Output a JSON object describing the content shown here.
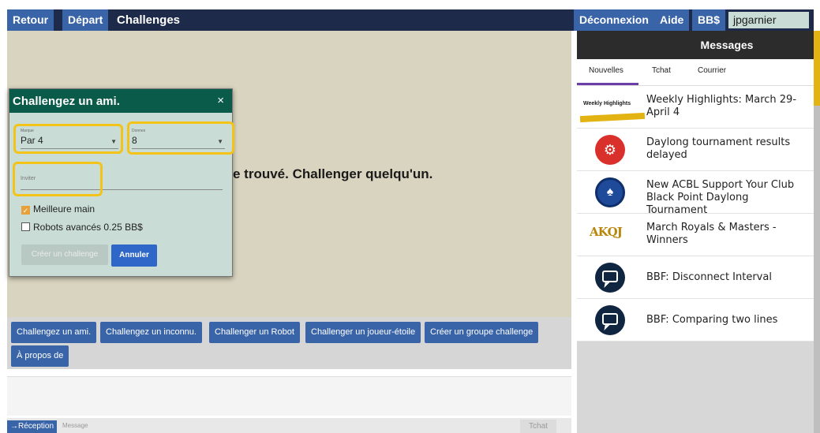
{
  "topbar": {
    "retour": "Retour",
    "depart": "Départ",
    "title": "Challenges",
    "deconnexion": "Déconnexion",
    "aide": "Aide",
    "bbs": "BB$",
    "username": "jpgarnier"
  },
  "main": {
    "empty_message": "e trouvé. Challenger quelqu'un."
  },
  "dialog": {
    "title": "Challengez un ami.",
    "close": "×",
    "scoring_label": "Marque",
    "scoring_value": "Par 4",
    "boards_label": "Donnes",
    "boards_value": "8",
    "invite_placeholder": "Inviter",
    "best_hand_label": "Meilleure main",
    "best_hand_checked": true,
    "robots_label": "Robots avancés 0.25 BB$",
    "robots_checked": false,
    "create_button": "Créer un challenge",
    "cancel_button": "Annuler",
    "highlight_color": "#f3c31a"
  },
  "actions": {
    "buttons": [
      "Challengez un ami.",
      "Challengez un inconnu.",
      "Challenger un Robot",
      "Challenger un joueur-étoile",
      "Créer un groupe challenge",
      "À propos de"
    ]
  },
  "chat": {
    "reception": "→Réception",
    "message_placeholder": "Message",
    "tchat_button": "Tchat"
  },
  "messages": {
    "title": "Messages",
    "tabs": [
      "Nouvelles",
      "Tchat",
      "Courrier"
    ],
    "active_tab": "Nouvelles",
    "items": [
      {
        "text": "Weekly Highlights: March 29-April 4",
        "icon_label": "Weekly Highlights"
      },
      {
        "text": "Daylong tournament results delayed",
        "icon": "gears-icon"
      },
      {
        "text": "New ACBL Support Your Club Black Point Daylong Tournament",
        "icon": "acbl-logo-icon"
      },
      {
        "text": "March Royals & Masters - Winners",
        "icon_label": "AKQJ"
      },
      {
        "text": "BBF: Disconnect Interval",
        "icon": "chat-bubble-icon"
      },
      {
        "text": "BBF: Comparing two lines",
        "icon": "chat-bubble-icon"
      }
    ]
  },
  "colors": {
    "topbar_bg": "#1e2a4a",
    "button_blue": "#3a64a8",
    "dialog_header": "#0b5b4a",
    "main_bg": "#d8d4bf"
  }
}
